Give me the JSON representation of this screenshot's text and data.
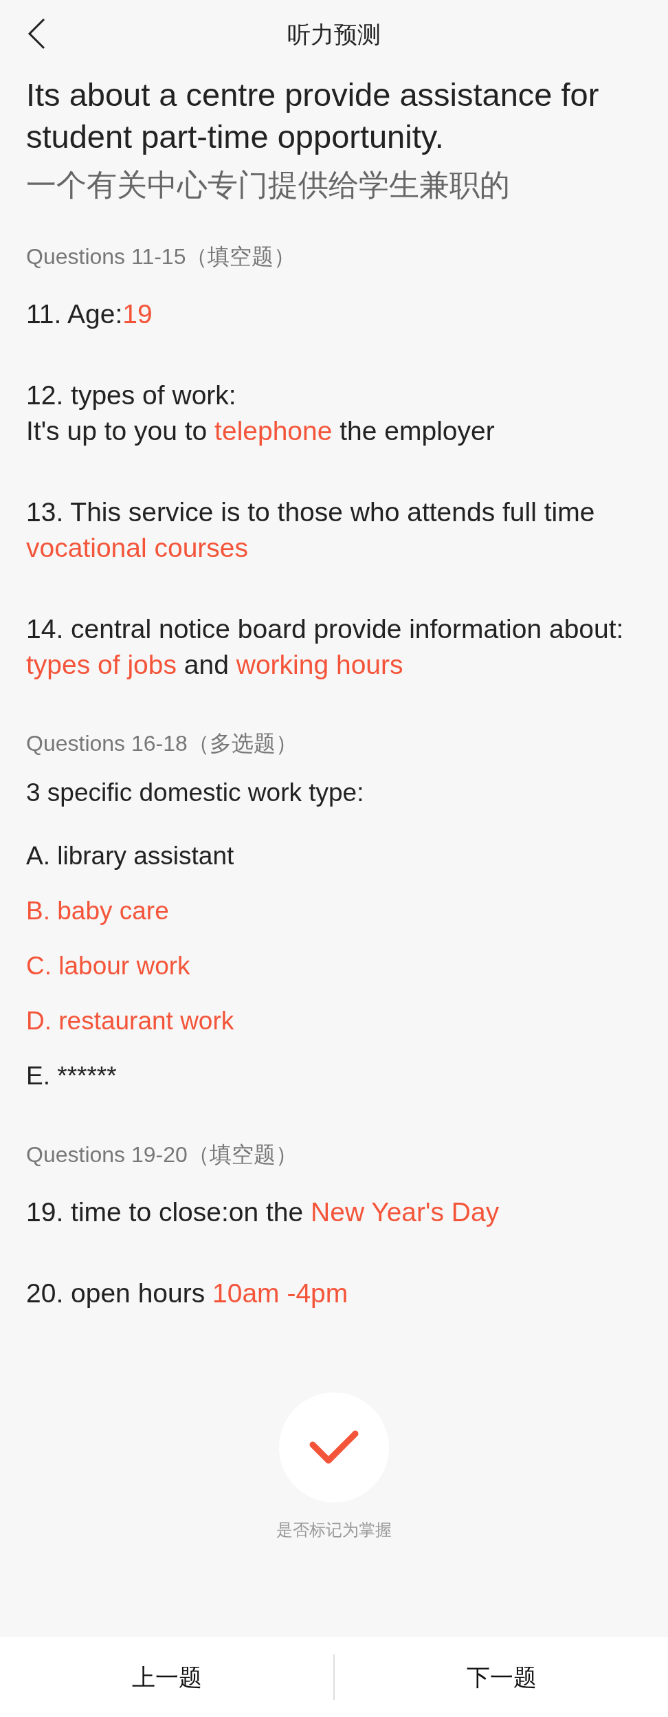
{
  "header": {
    "title": "听力预测"
  },
  "intro": {
    "english": "Its about a centre provide assistance for student part-time opportunity.",
    "chinese": "一个有关中心专门提供给学生兼职的"
  },
  "sections": [
    {
      "kind": "fill",
      "heading": "Questions 11-15（填空题）",
      "items": [
        {
          "lines": [
            [
              {
                "text": "11. Age:",
                "answer": false
              },
              {
                "text": "19",
                "answer": true
              }
            ]
          ]
        },
        {
          "lines": [
            [
              {
                "text": "12. types of work:",
                "answer": false
              }
            ],
            [
              {
                "text": "It's up to you to ",
                "answer": false
              },
              {
                "text": "telephone",
                "answer": true
              },
              {
                "text": " the employer",
                "answer": false
              }
            ]
          ]
        },
        {
          "lines": [
            [
              {
                "text": "13. This service is to those who attends full time ",
                "answer": false
              },
              {
                "text": "vocational courses",
                "answer": true
              }
            ]
          ]
        },
        {
          "lines": [
            [
              {
                "text": "14. central notice board provide information about: ",
                "answer": false
              },
              {
                "text": "types of jobs",
                "answer": true
              },
              {
                "text": " and ",
                "answer": false
              },
              {
                "text": "working hours",
                "answer": true
              }
            ]
          ]
        }
      ]
    },
    {
      "kind": "choice",
      "heading": "Questions 16-18（多选题）",
      "prompt": "3 specific domestic work type:",
      "options": [
        {
          "label": "A. library assistant",
          "answer": false
        },
        {
          "label": "B. baby care",
          "answer": true
        },
        {
          "label": "C. labour work",
          "answer": true
        },
        {
          "label": "D. restaurant work",
          "answer": true
        },
        {
          "label": "E. ******",
          "answer": false
        }
      ]
    },
    {
      "kind": "fill",
      "heading": "Questions 19-20（填空题）",
      "items": [
        {
          "lines": [
            [
              {
                "text": "19. time to close:on the ",
                "answer": false
              },
              {
                "text": "New Year's Day",
                "answer": true
              }
            ]
          ]
        },
        {
          "lines": [
            [
              {
                "text": "20. open hours ",
                "answer": false
              },
              {
                "text": "10am -4pm",
                "answer": true
              }
            ]
          ]
        }
      ]
    }
  ],
  "mastery": {
    "label": "是否标记为掌握"
  },
  "footer": {
    "buttons": [
      "上一题",
      "下一题"
    ]
  }
}
